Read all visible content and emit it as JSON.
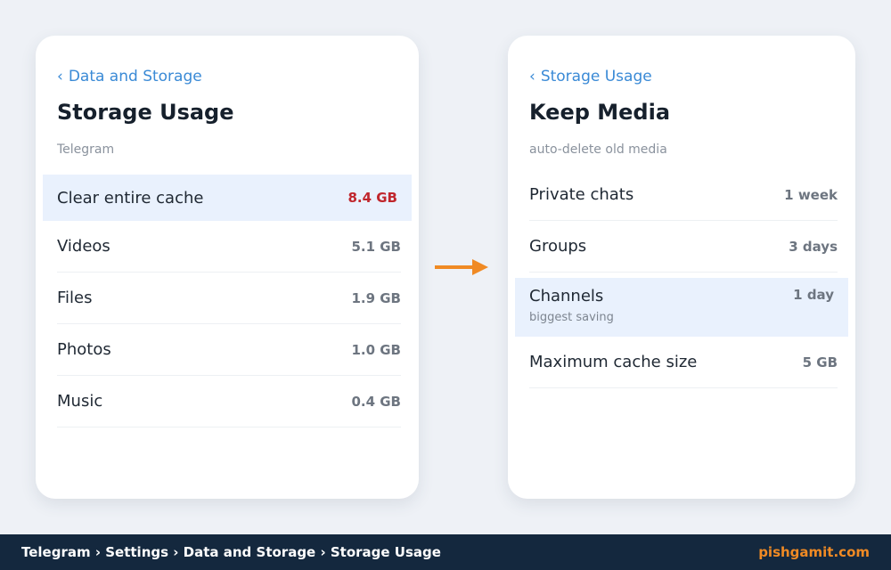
{
  "left_panel": {
    "back_label": "Data and Storage",
    "title": "Storage Usage",
    "subtitle": "Telegram",
    "rows": [
      {
        "label": "Clear entire cache",
        "value": "8.4 GB"
      },
      {
        "label": "Videos",
        "value": "5.1 GB"
      },
      {
        "label": "Files",
        "value": "1.9 GB"
      },
      {
        "label": "Photos",
        "value": "1.0 GB"
      },
      {
        "label": "Music",
        "value": "0.4 GB"
      }
    ]
  },
  "right_panel": {
    "back_label": "Storage Usage",
    "title": "Keep Media",
    "subtitle": "auto-delete old media",
    "rows": [
      {
        "label": "Private chats",
        "value": "1 week"
      },
      {
        "label": "Groups",
        "value": "3 days"
      },
      {
        "label": "Channels",
        "value": "1 day",
        "note": "biggest saving"
      },
      {
        "label": "Maximum cache size",
        "value": "5 GB"
      }
    ]
  },
  "footer": {
    "breadcrumb": "Telegram › Settings › Data and Storage › Storage Usage",
    "brand": "pishgamit.com"
  },
  "colors": {
    "accent": "#3a8ad6",
    "danger": "#c0262c",
    "highlight": "#e9f1fd",
    "arrow": "#f08a24",
    "footer_bg": "#14283e"
  },
  "icons": {
    "back": "chevron-left-icon",
    "flow": "arrow-right-icon"
  }
}
